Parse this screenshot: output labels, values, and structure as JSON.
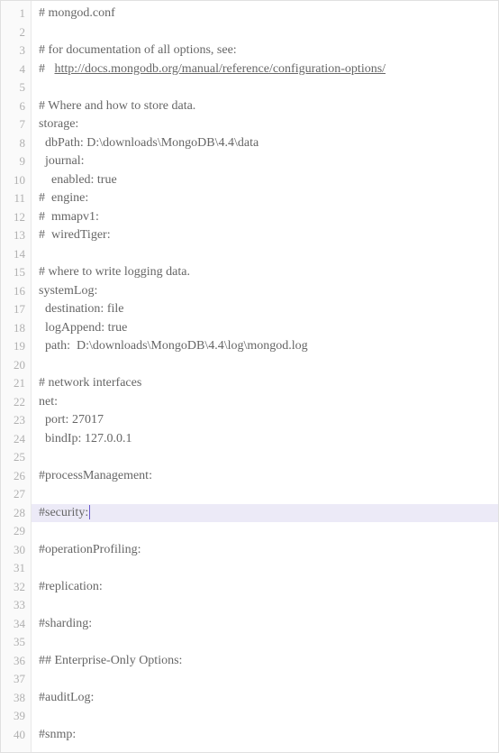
{
  "editor": {
    "highlight_line": 28,
    "cursor_line": 28,
    "lines": [
      {
        "n": 1,
        "text": "# mongod.conf"
      },
      {
        "n": 2,
        "text": ""
      },
      {
        "n": 3,
        "text": "# for documentation of all options, see:"
      },
      {
        "n": 4,
        "text": "#   ",
        "link": "http://docs.mongodb.org/manual/reference/configuration-options/"
      },
      {
        "n": 5,
        "text": ""
      },
      {
        "n": 6,
        "text": "# Where and how to store data."
      },
      {
        "n": 7,
        "text": "storage:"
      },
      {
        "n": 8,
        "text": "  dbPath: D:\\downloads\\MongoDB\\4.4\\data"
      },
      {
        "n": 9,
        "text": "  journal:"
      },
      {
        "n": 10,
        "text": "    enabled: true"
      },
      {
        "n": 11,
        "text": "#  engine:"
      },
      {
        "n": 12,
        "text": "#  mmapv1:"
      },
      {
        "n": 13,
        "text": "#  wiredTiger:"
      },
      {
        "n": 14,
        "text": ""
      },
      {
        "n": 15,
        "text": "# where to write logging data."
      },
      {
        "n": 16,
        "text": "systemLog:"
      },
      {
        "n": 17,
        "text": "  destination: file"
      },
      {
        "n": 18,
        "text": "  logAppend: true"
      },
      {
        "n": 19,
        "text": "  path:  D:\\downloads\\MongoDB\\4.4\\log\\mongod.log"
      },
      {
        "n": 20,
        "text": ""
      },
      {
        "n": 21,
        "text": "# network interfaces"
      },
      {
        "n": 22,
        "text": "net:"
      },
      {
        "n": 23,
        "text": "  port: 27017"
      },
      {
        "n": 24,
        "text": "  bindIp: 127.0.0.1"
      },
      {
        "n": 25,
        "text": ""
      },
      {
        "n": 26,
        "text": "#processManagement:"
      },
      {
        "n": 27,
        "text": ""
      },
      {
        "n": 28,
        "text": "#security:"
      },
      {
        "n": 29,
        "text": ""
      },
      {
        "n": 30,
        "text": "#operationProfiling:"
      },
      {
        "n": 31,
        "text": ""
      },
      {
        "n": 32,
        "text": "#replication:"
      },
      {
        "n": 33,
        "text": ""
      },
      {
        "n": 34,
        "text": "#sharding:"
      },
      {
        "n": 35,
        "text": ""
      },
      {
        "n": 36,
        "text": "## Enterprise-Only Options:"
      },
      {
        "n": 37,
        "text": ""
      },
      {
        "n": 38,
        "text": "#auditLog:"
      },
      {
        "n": 39,
        "text": ""
      },
      {
        "n": 40,
        "text": "#snmp:"
      }
    ]
  }
}
